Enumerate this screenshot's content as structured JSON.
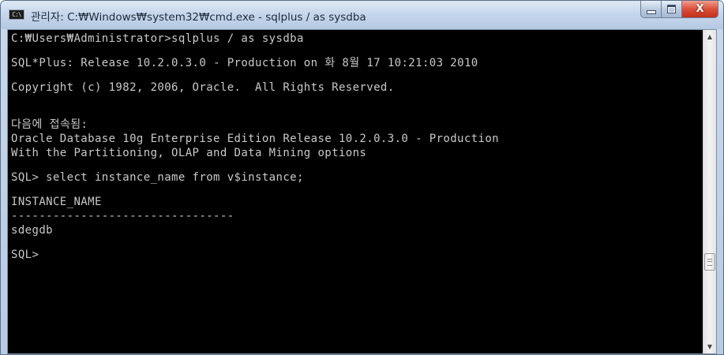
{
  "window": {
    "title": "관리자: C:₩Windows₩system32₩cmd.exe - sqlplus  / as sysdba",
    "icon": "console-app-icon",
    "icon_label": "C:\\",
    "controls": {
      "minimize_icon": "minimize-icon",
      "maximize_icon": "maximize-icon",
      "close_icon": "close-icon",
      "close_glyph": "X"
    }
  },
  "console": {
    "lines": [
      "C:₩Users₩Administrator>sqlplus / as sysdba",
      "",
      "SQL*Plus: Release 10.2.0.3.0 - Production on 화 8월 17 10:21:03 2010",
      "",
      "Copyright (c) 1982, 2006, Oracle.  All Rights Reserved.",
      "",
      "다음에 접속됨:",
      "Oracle Database 10g Enterprise Edition Release 10.2.0.3.0 - Production",
      "With the Partitioning, OLAP and Data Mining options",
      "",
      "SQL> select instance_name from v$instance;",
      "",
      "INSTANCE_NAME",
      "--------------------------------",
      "sdegdb",
      "",
      "SQL>"
    ]
  },
  "scrollbar": {
    "up_glyph": "▲",
    "down_glyph": "▼",
    "up_icon": "scroll-up-arrow-icon",
    "down_icon": "scroll-down-arrow-icon",
    "position": 0.75
  },
  "colors": {
    "console_bg": "#000000",
    "console_fg": "#c0c0c0",
    "titlebar": "#c6d7ec",
    "close_button": "#c8402a"
  }
}
